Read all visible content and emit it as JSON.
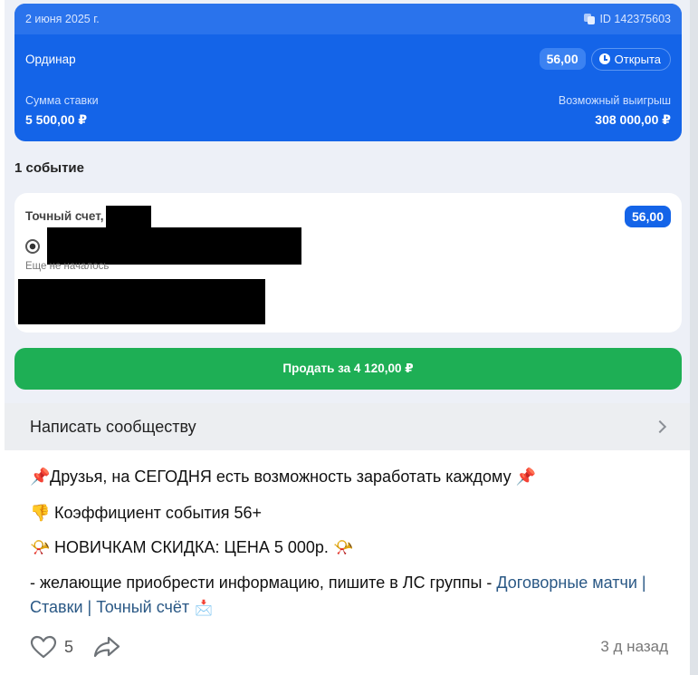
{
  "ticket": {
    "date": "2 июня 2025 г.",
    "id_label": "ID 142375603",
    "type": "Ординар",
    "coefficient": "56,00",
    "status": "Открыта",
    "stake_label": "Сумма ставки",
    "stake_value": "5 500,00 ₽",
    "win_label": "Возможный выигрыш",
    "win_value": "308 000,00 ₽"
  },
  "events_count": "1 событие",
  "event": {
    "title": "Точный счет,",
    "coefficient": "56,00",
    "status": "Еще не началось"
  },
  "sell_button": "Продать за 4 120,00 ₽",
  "community": {
    "label": "Написать сообществу"
  },
  "post": {
    "line1": "Друзья, на СЕГОДНЯ есть возможность заработать каждому",
    "line2": "Коэффициент события 56+",
    "line3": "НОВИЧКАМ СКИДКА: ЦЕНА 5 000р.",
    "line4_text": "- желающие приобрести информацию, пишите в ЛС группы - ",
    "line4_link": "Договорные матчи | Ставки | Точный счёт",
    "likes": "5",
    "time_ago": "3 д назад"
  },
  "icons": {
    "copy": "copy-icon",
    "clock": "clock-icon",
    "ball": "soccer-ball-icon",
    "pin": "pushpin-icon",
    "hand": "thumbs-down-icon",
    "horn": "horn-icon",
    "inbox": "inbox-tray-icon",
    "heart": "heart-icon",
    "share": "share-icon",
    "chevron": "chevron-right-icon"
  },
  "colors": {
    "ticket_blue": "#1464e8",
    "sell_green": "#1eaf55",
    "link": "#2a5885"
  }
}
